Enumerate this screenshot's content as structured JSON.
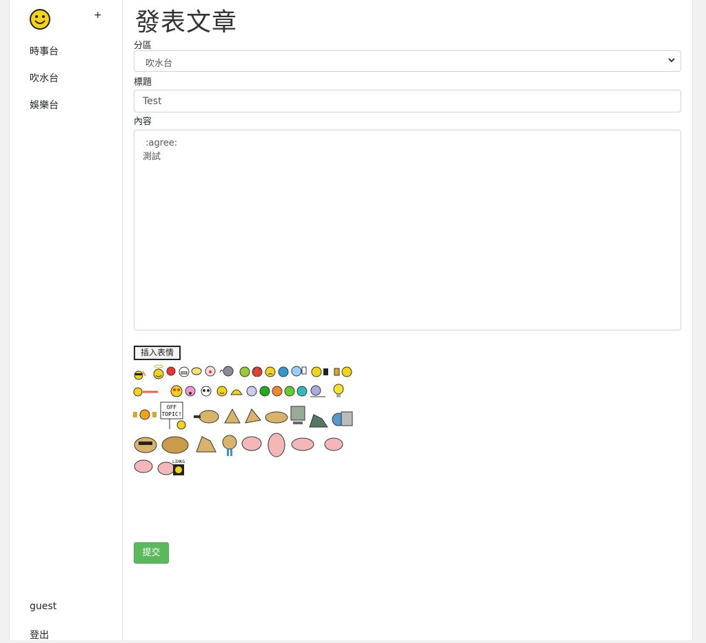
{
  "sidebar": {
    "logo_icon": "smiley-icon",
    "add_label": "+",
    "items": [
      {
        "label": "時事台"
      },
      {
        "label": "吹水台"
      },
      {
        "label": "娛樂台"
      }
    ],
    "username": "guest",
    "logout_label": "登出"
  },
  "main": {
    "title": "發表文章",
    "category_label": "分區",
    "category_value": "吹水台",
    "subject_label": "標題",
    "subject_value": "Test",
    "content_label": "內容",
    "content_value": " :agree:\n測試",
    "insert_emoji_label": "插入表情",
    "submit_label": "提交",
    "emote_sign_text": "OFF TOPIC!",
    "emote_lihkg_text": "LIHKG"
  },
  "colors": {
    "submit": "#5cb85c",
    "smiley_yellow": "#f2d21b"
  }
}
